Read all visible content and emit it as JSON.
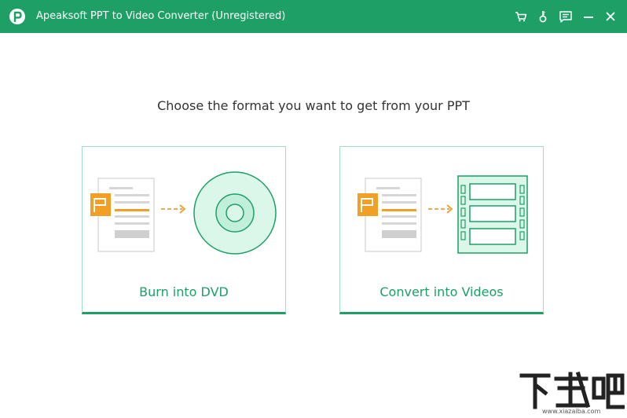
{
  "window": {
    "title": "Apeaksoft PPT to Video Converter (Unregistered)",
    "accent_color": "#1d9f66",
    "controls": [
      "cart-icon",
      "key-icon",
      "feedback-icon",
      "minimize-icon",
      "close-icon"
    ]
  },
  "main": {
    "heading": "Choose the format you want to get from your PPT",
    "options": [
      {
        "label": "Burn into DVD",
        "icon": "dvd-illustration"
      },
      {
        "label": "Convert into Videos",
        "icon": "video-film-illustration"
      }
    ]
  },
  "watermark": {
    "text": "下载吧",
    "subtext": "www.xiazaiba.com"
  }
}
